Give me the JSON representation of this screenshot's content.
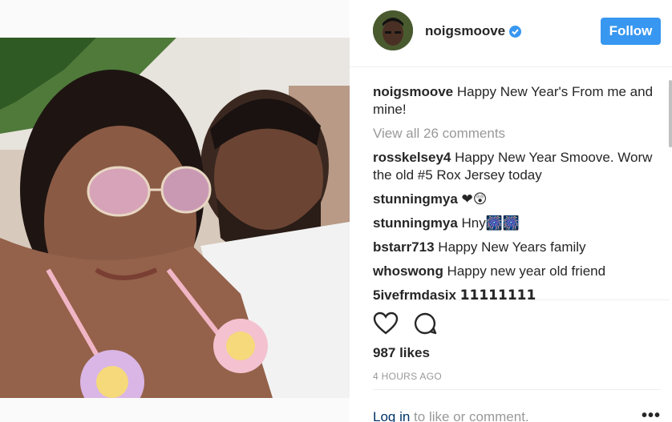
{
  "post": {
    "username": "noigsmoove",
    "follow_label": "Follow",
    "caption_user": "noigsmoove",
    "caption_text": " Happy New Year's From me and mine!",
    "view_all_comments": "View all 26 comments",
    "comments": [
      {
        "user": "rosskelsey4",
        "text": " Happy New Year Smoove. Worw the old #5 Rox Jersey today"
      },
      {
        "user": "stunningmya",
        "text": " ❤😲"
      },
      {
        "user": "stunningmya",
        "text": " Hny🎆🎆"
      },
      {
        "user": "bstarr713",
        "text": " Happy New Years family"
      },
      {
        "user": "whoswong",
        "text": " Happy new year old friend"
      },
      {
        "user": "5ivefrmdasix",
        "text": " 𝟭𝟭𝟭𝟭𝟭𝟭𝟭𝟭"
      }
    ],
    "likes": "987 likes",
    "timestamp": "4 HOURS AGO",
    "login_link": "Log in",
    "login_suffix": " to like or comment.",
    "more_label": "•••"
  },
  "colors": {
    "accent": "#3897f0",
    "muted": "#999999",
    "text": "#262626"
  },
  "icons": {
    "verified": "verified-badge-icon",
    "like": "heart-icon",
    "comment": "comment-bubble-icon",
    "more": "more-options-icon"
  }
}
